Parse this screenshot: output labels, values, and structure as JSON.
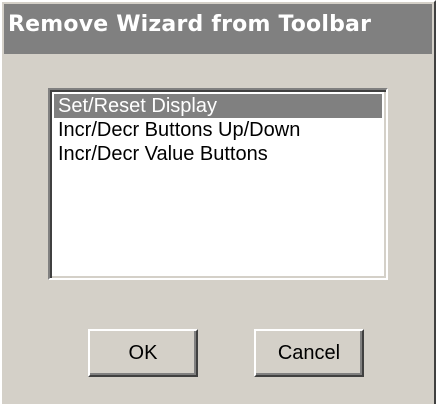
{
  "dialog": {
    "title": "Remove Wizard from Toolbar",
    "wizards": [
      {
        "label": "Set/Reset Display",
        "selected": true
      },
      {
        "label": "Incr/Decr Buttons Up/Down",
        "selected": false
      },
      {
        "label": "Incr/Decr Value Buttons",
        "selected": false
      }
    ],
    "ok_label": "OK",
    "cancel_label": "Cancel"
  }
}
